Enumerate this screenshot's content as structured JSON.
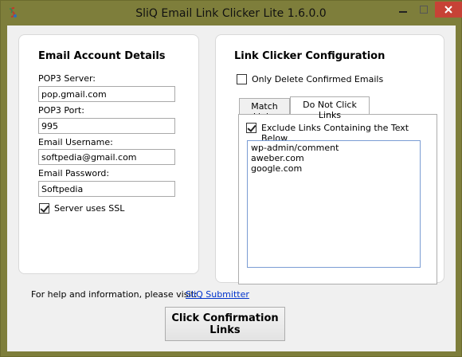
{
  "window": {
    "title": "SliQ Email Link Clicker Lite 1.6.0.0",
    "titlebar_color": "#7e7e3b",
    "close_color": "#c74236"
  },
  "email_account": {
    "title": "Email Account Details",
    "pop3_server_label": "POP3 Server:",
    "pop3_server_value": "pop.gmail.com",
    "pop3_port_label": "POP3 Port:",
    "pop3_port_value": "995",
    "username_label": "Email Username:",
    "username_value": "softpedia@gmail.com",
    "password_label": "Email Password:",
    "password_value": "Softpedia",
    "ssl_label": "Server uses SSL",
    "ssl_checked": true
  },
  "link_clicker": {
    "title": "Link Clicker Configuration",
    "only_delete_label": "Only Delete Confirmed Emails",
    "only_delete_checked": false,
    "tabs": [
      {
        "label": "Match Links",
        "active": false
      },
      {
        "label": "Do Not Click Links",
        "active": true
      }
    ],
    "exclude_label": "Exclude Links Containing the Text Below",
    "exclude_checked": true,
    "exclude_lines": [
      "wp-admin/comment",
      "aweber.com",
      "google.com"
    ]
  },
  "footer": {
    "help_text": "For help and information, please visit:",
    "link_text": "SliQ Submitter",
    "button_line1": "Click Confirmation",
    "button_line2": "Links"
  }
}
